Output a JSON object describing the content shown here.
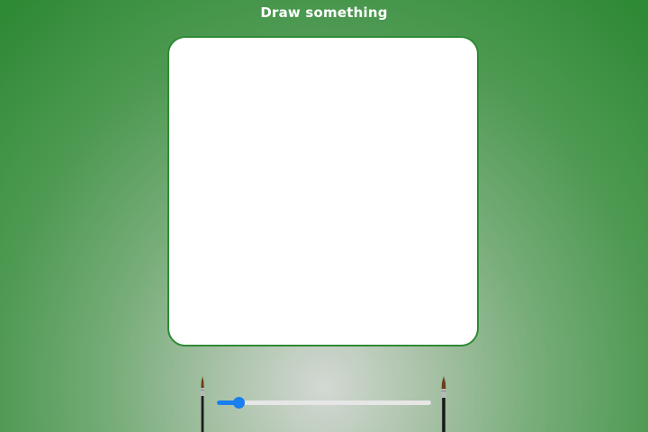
{
  "header": {
    "title": "Draw something"
  },
  "canvas": {
    "background": "#ffffff",
    "border_color": "#2e8b34"
  },
  "brush_size_slider": {
    "value_fraction": 0.1,
    "accent_color": "#1a7ff0",
    "track_color": "#e6e6e6"
  },
  "icons": {
    "left": "small-brush-icon",
    "right": "large-brush-icon"
  },
  "colors": {
    "background_outer": "#2f8a36",
    "background_center": "#d3d8d3"
  }
}
